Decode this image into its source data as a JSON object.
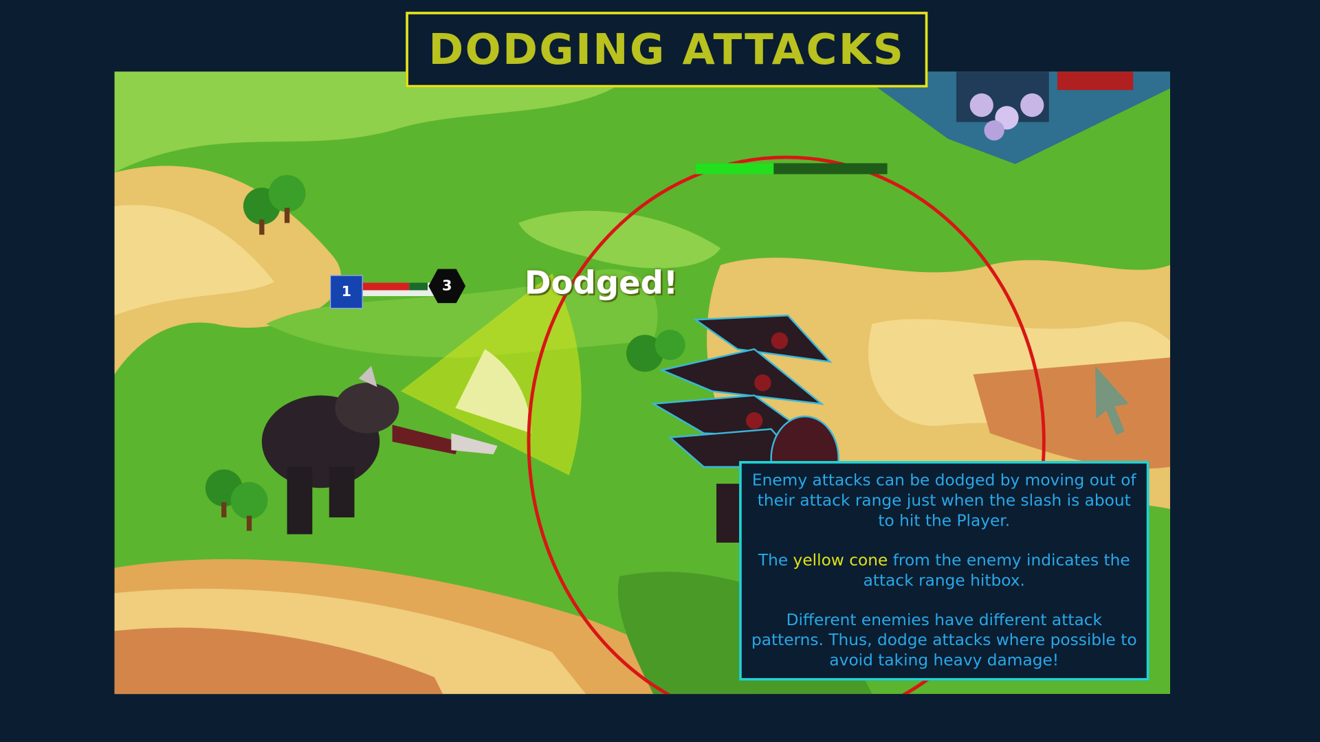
{
  "title": "DODGING ATTACKS",
  "combat_text": "Dodged!",
  "player": {
    "level_badge": "1",
    "rank_badge": "3",
    "health_fraction": 0.65
  },
  "enemy": {
    "health_fraction": 0.41
  },
  "info_panel": {
    "paragraph1": "Enemy attacks can be dodged by moving out of their attack range just when the slash is about to hit the Player.",
    "paragraph2_before": "The ",
    "paragraph2_highlight": "yellow cone",
    "paragraph2_after": " from the enemy indicates the attack range hitbox.",
    "paragraph3": "Different enemies have different attack patterns. Thus, dodge attacks where possible to avoid taking heavy damage!"
  },
  "colors": {
    "background": "#0b1d31",
    "title_border": "#e4e21b",
    "title_text": "#b9c21f",
    "info_border": "#20d4d4",
    "info_text": "#28a8e8",
    "highlight": "#dde31a",
    "attack_range_ring": "#d81616",
    "player_health": "#d62020",
    "enemy_health": "#22e01e"
  }
}
